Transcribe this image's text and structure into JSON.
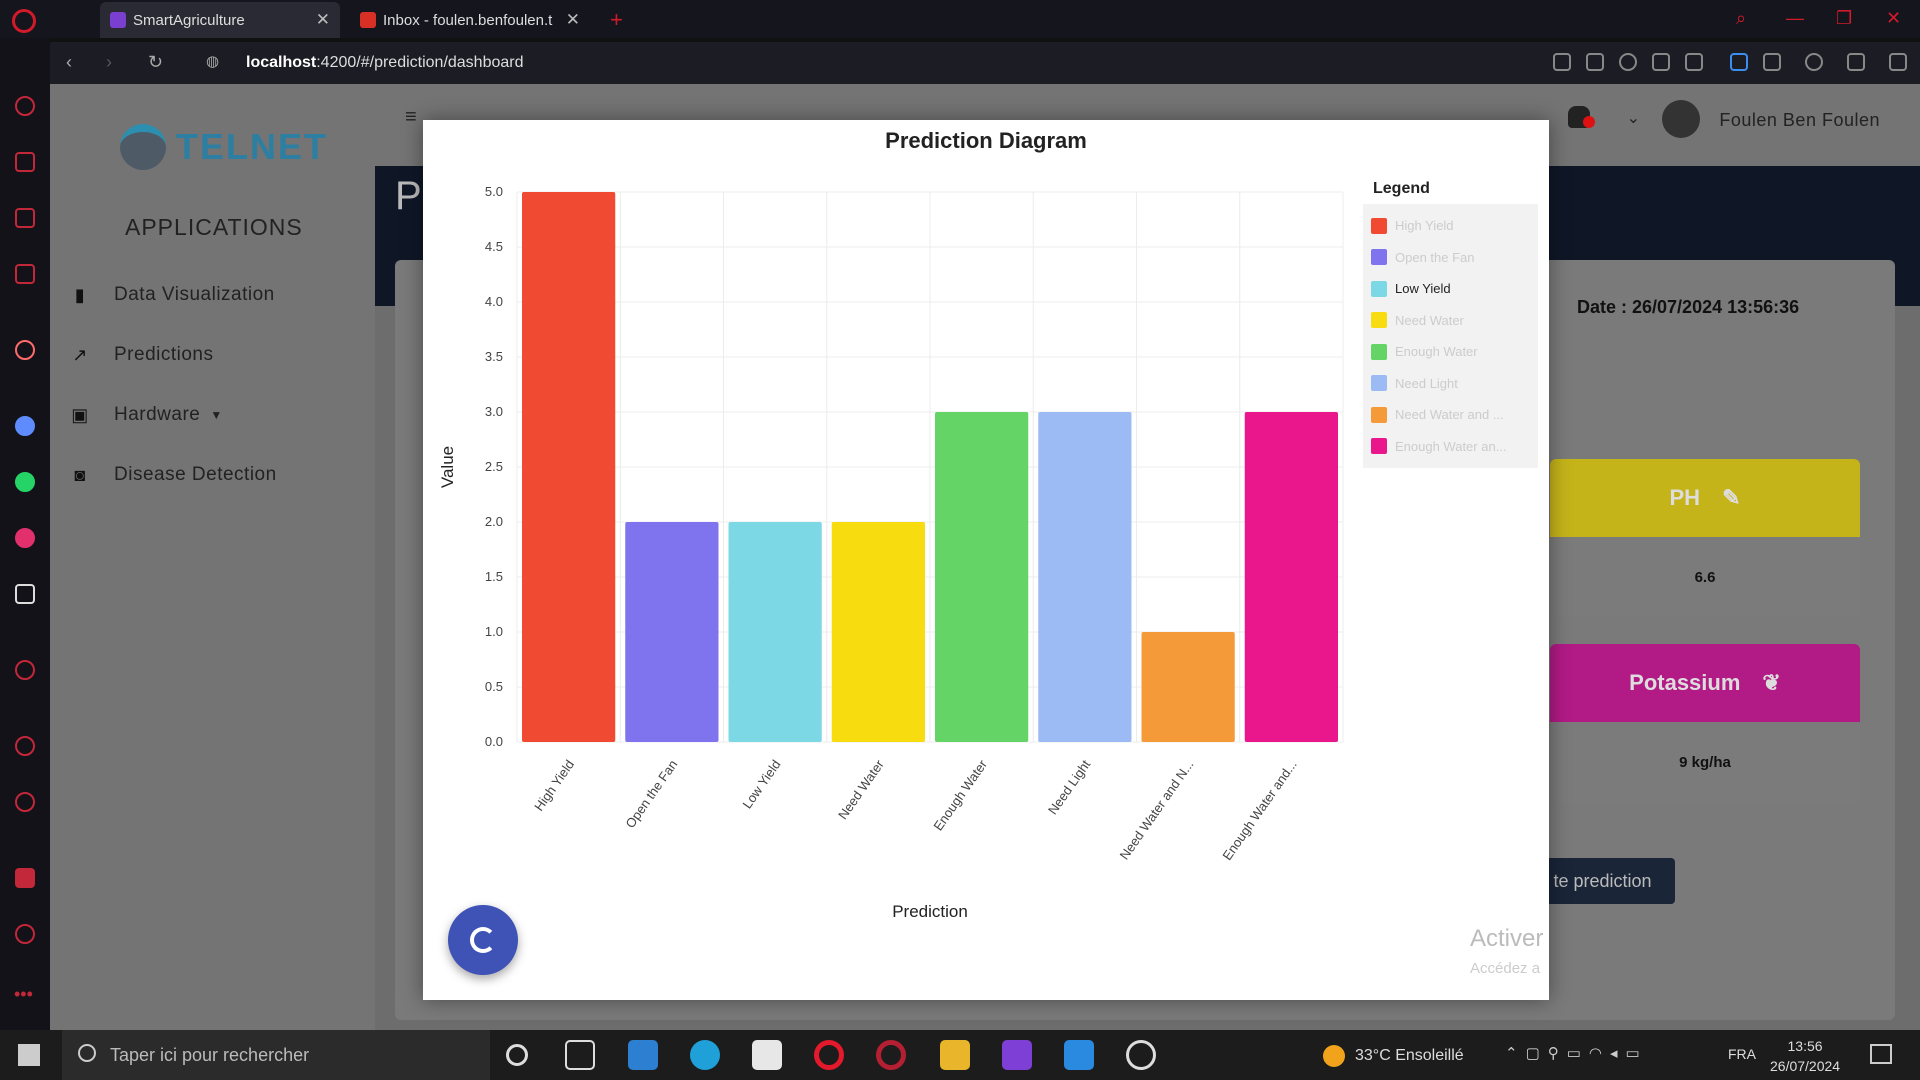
{
  "browser": {
    "tabs": [
      {
        "label": "SmartAgriculture",
        "active": true
      },
      {
        "label": "Inbox - foulen.benfoulen.t",
        "active": false
      }
    ],
    "url_host": "localhost",
    "url_path": ":4200/#/prediction/dashboard"
  },
  "app": {
    "logo_text": "TELNET",
    "applications_title": "APPLICATIONS",
    "menu": [
      {
        "label": "Data Visualization",
        "icon": "bar-chart-icon"
      },
      {
        "label": "Predictions",
        "icon": "trend-icon"
      },
      {
        "label": "Hardware",
        "icon": "chip-icon"
      },
      {
        "label": "Disease Detection",
        "icon": "camera-icon"
      }
    ],
    "user_name": "Foulen Ben Foulen",
    "page_title_initial": "P",
    "date_text": "Date : 26/07/2024 13:56:36",
    "sensors": [
      {
        "title": "PH",
        "value": "6.6",
        "color": "#c5b31a"
      },
      {
        "title": "Potassium",
        "value": "9 kg/ha",
        "color": "#b21a86"
      }
    ],
    "prediction_button": "te prediction"
  },
  "modal": {
    "title": "Prediction Diagram",
    "legend_title": "Legend",
    "fab_icon": "pie-chart-icon",
    "watermark_title": "Activer",
    "watermark_sub": "Accédez a"
  },
  "chart_data": {
    "type": "bar",
    "title": "Prediction Diagram",
    "xlabel": "Prediction",
    "ylabel": "Value",
    "ylim": [
      0,
      5
    ],
    "yticks": [
      "0.0",
      "0.5",
      "1.0",
      "1.5",
      "2.0",
      "2.5",
      "3.0",
      "3.5",
      "4.0",
      "4.5",
      "5.0"
    ],
    "categories": [
      "High Yield",
      "Open the Fan",
      "Low Yield",
      "Need Water",
      "Enough Water",
      "Need Light",
      "Need Water and N...",
      "Enough Water and..."
    ],
    "values": [
      5,
      2,
      2,
      2,
      3,
      3,
      1,
      3
    ],
    "colors": [
      "#f04a33",
      "#7f74ee",
      "#7dd8e6",
      "#f7dd10",
      "#63d465",
      "#9cbbf5",
      "#f49a38",
      "#ea168c"
    ],
    "legend": [
      {
        "label": "High Yield",
        "active": false
      },
      {
        "label": "Open the Fan",
        "active": false
      },
      {
        "label": "Low Yield",
        "active": true
      },
      {
        "label": "Need Water",
        "active": false
      },
      {
        "label": "Enough Water",
        "active": false
      },
      {
        "label": "Need Light",
        "active": false
      },
      {
        "label": "Need Water and ...",
        "active": false
      },
      {
        "label": "Enough Water an...",
        "active": false
      }
    ],
    "legend_placement": "right",
    "grid": true
  },
  "taskbar": {
    "search_placeholder": "Taper ici pour rechercher",
    "weather": "33°C  Ensoleillé",
    "lang": "FRA",
    "time": "13:56",
    "date": "26/07/2024"
  }
}
